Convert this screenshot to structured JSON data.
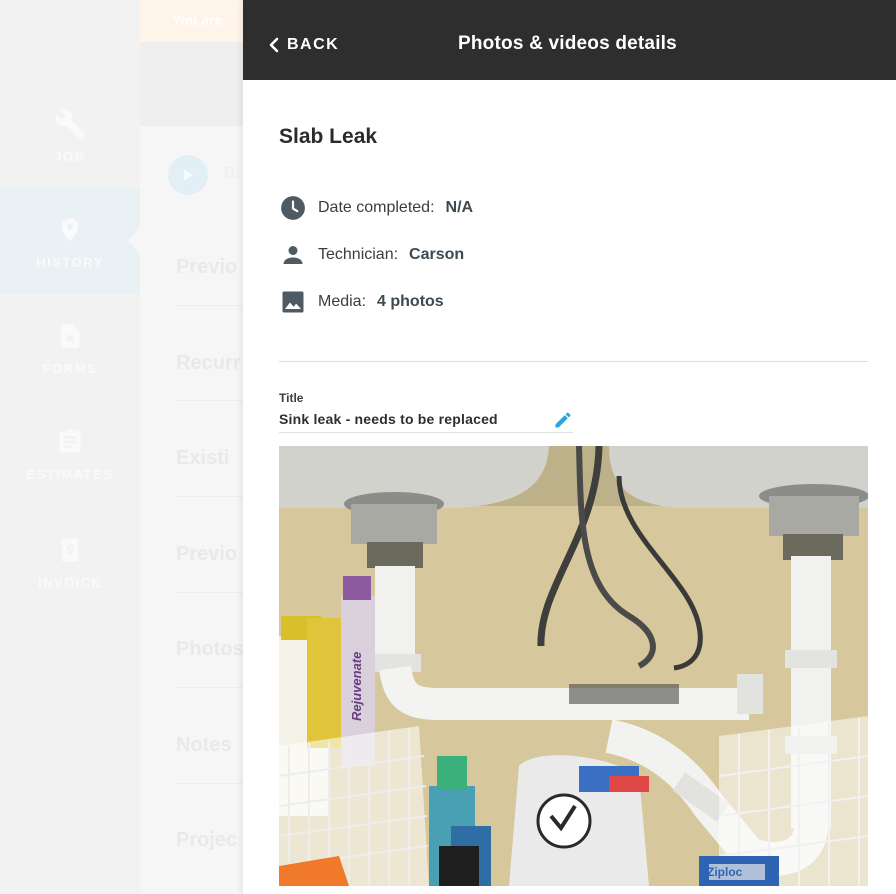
{
  "sidebar": {
    "items": [
      {
        "label": "JOB",
        "icon": "wrench-icon"
      },
      {
        "label": "HISTORY",
        "icon": "location-pin-icon"
      },
      {
        "label": "FORMS",
        "icon": "form-search-icon"
      },
      {
        "label": "ESTIMATES",
        "icon": "clipboard-icon"
      },
      {
        "label": "INVOICE",
        "icon": "invoice-icon"
      }
    ]
  },
  "background": {
    "banner_text": "You are",
    "b_text": "Bi",
    "rows": [
      "Previo",
      "Recurr",
      "Existi",
      "Previo",
      "Photos",
      "Notes",
      "Projec"
    ]
  },
  "panel": {
    "back_label": "BACK",
    "title": "Photos & videos details",
    "job_title": "Slab Leak",
    "info": {
      "date_label": "Date completed:",
      "date_value": "N/A",
      "tech_label": "Technician:",
      "tech_value": "Carson",
      "media_label": "Media:",
      "media_value": "4 photos"
    },
    "field": {
      "label": "Title",
      "value": "Sink leak - needs to be replaced"
    },
    "photo": {
      "products": {
        "bottle_label": "Rejuvenate",
        "box_label": "Ziploc"
      }
    }
  },
  "colors": {
    "topbar": "#2e2e2e",
    "accent": "#2aa4dc",
    "icon_gray": "#4f5b62"
  }
}
